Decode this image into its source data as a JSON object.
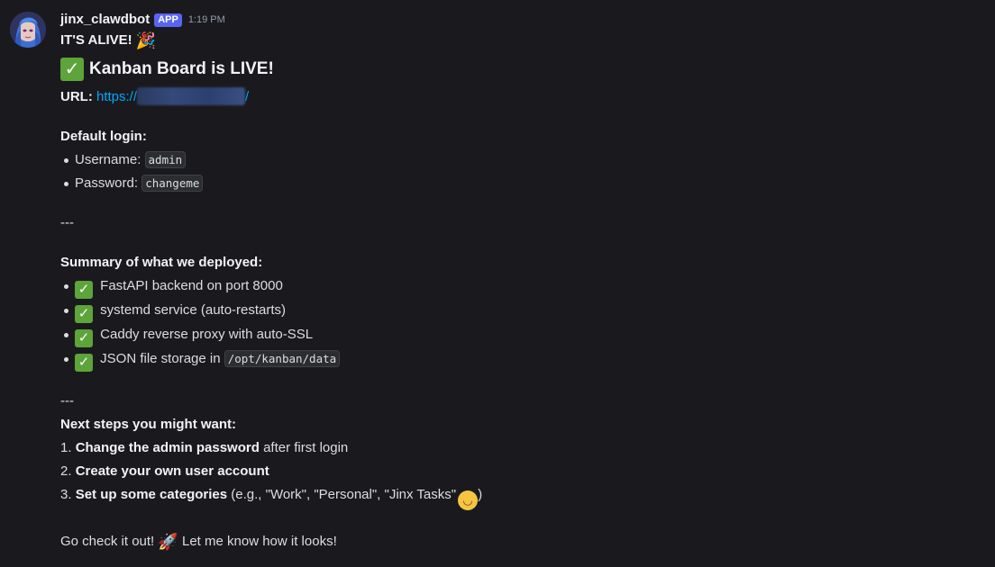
{
  "message": {
    "username": "jinx_clawdbot",
    "tag": "APP",
    "timestamp": "1:19 PM",
    "intro": "IT'S ALIVE!",
    "intro_emoji": "party-popper",
    "heading": "Kanban Board is LIVE!",
    "url_label": "URL:",
    "url_prefix": "https://",
    "url_suffix": "/",
    "login_heading": "Default login:",
    "login_items": [
      {
        "label": "Username:",
        "value": "admin"
      },
      {
        "label": "Password:",
        "value": "changeme"
      }
    ],
    "separator_1": "---",
    "summary_heading": "Summary of what we deployed:",
    "summary_items": [
      {
        "text": "FastAPI backend on port 8000"
      },
      {
        "text": "systemd service (auto-restarts)"
      },
      {
        "text": "Caddy reverse proxy with auto-SSL"
      },
      {
        "text": "JSON file storage in",
        "code": "/opt/kanban/data"
      }
    ],
    "separator_2": "---",
    "next_heading": "Next steps you might want:",
    "next_steps": [
      {
        "num": "1.",
        "bold": "Change the admin password",
        "rest": "after first login"
      },
      {
        "num": "2.",
        "bold": "Create your own user account",
        "rest": ""
      },
      {
        "num": "3.",
        "bold": "Set up some categories",
        "rest": "(e.g., \"Work\", \"Personal\", \"Jinx Tasks\"",
        "close": ")"
      }
    ],
    "closing_a": "Go check it out!",
    "closing_b": "Let me know how it looks!"
  },
  "colors": {
    "background": "#1a1a1e",
    "text": "#dbdee1",
    "link": "#00a8fc",
    "app_tag": "#5865f2",
    "check": "#5da43a"
  }
}
